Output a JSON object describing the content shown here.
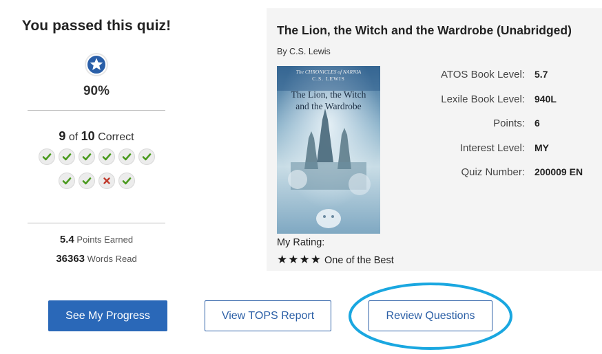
{
  "result": {
    "title": "You passed this quiz!",
    "percent": "90%",
    "correct_count": "9",
    "of_text": "of",
    "total_count": "10",
    "correct_word": "Correct",
    "answers_row1": [
      "correct",
      "correct",
      "correct",
      "correct",
      "correct",
      "correct"
    ],
    "answers_row2": [
      "correct",
      "correct",
      "incorrect",
      "correct"
    ],
    "points_value": "5.4",
    "points_label": "Points Earned",
    "words_value": "36363",
    "words_label": "Words Read"
  },
  "book": {
    "title": "The Lion, the Witch and the Wardrobe (Unabridged)",
    "author": "By C.S. Lewis",
    "cover": {
      "series": "The CHRONICLES of NARNIA",
      "author": "C.S. LEWIS",
      "title_line1": "The Lion, the Witch",
      "title_line2": "and the Wardrobe"
    },
    "info": [
      {
        "label": "ATOS Book Level:",
        "value": "5.7"
      },
      {
        "label": "Lexile Book Level:",
        "value": "940L"
      },
      {
        "label": "Points:",
        "value": "6"
      },
      {
        "label": "Interest Level:",
        "value": "MY"
      },
      {
        "label": "Quiz Number:",
        "value": "200009 EN"
      }
    ],
    "rating_label": "My Rating:",
    "rating_stars": 4,
    "rating_stars_glyph": "★★★★",
    "rating_text": "One of the Best"
  },
  "buttons": {
    "progress": "See My Progress",
    "tops": "View TOPS Report",
    "review": "Review Questions"
  },
  "colors": {
    "primary": "#2a68b8",
    "correct": "#4a9a1e",
    "incorrect": "#c0392b",
    "highlight_ring": "#1aa7e0",
    "panel_bg": "#f4f4f4"
  }
}
